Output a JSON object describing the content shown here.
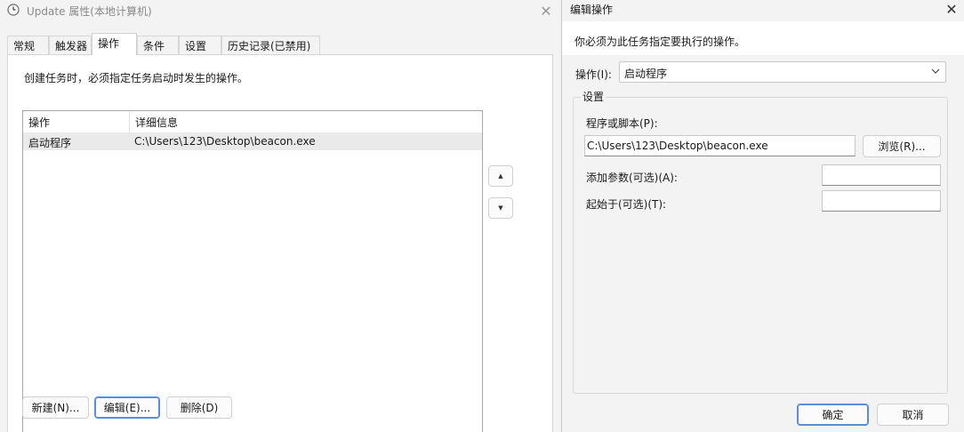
{
  "left_window": {
    "title": "Update 属性(本地计算机)",
    "tabs": [
      "常规",
      "触发器",
      "操作",
      "条件",
      "设置",
      "历史记录(已禁用)"
    ],
    "active_tab_index": 2,
    "description": "创建任务时，必须指定任务启动时发生的操作。",
    "table": {
      "headers": [
        "操作",
        "详细信息"
      ],
      "rows": [
        {
          "action": "启动程序",
          "details": "C:\\Users\\123\\Desktop\\beacon.exe"
        }
      ]
    },
    "buttons": {
      "new": "新建(N)...",
      "edit": "编辑(E)...",
      "delete": "删除(D)"
    },
    "icons": {
      "app": "clock-icon",
      "close": "close-icon",
      "move_up": "triangle-up-icon",
      "move_down": "triangle-down-icon"
    }
  },
  "right_window": {
    "title": "编辑操作",
    "instruction": "你必须为此任务指定要执行的操作。",
    "action_label": "操作(I):",
    "action_value": "启动程序",
    "settings_legend": "设置",
    "program_label": "程序或脚本(P):",
    "program_value": "C:\\Users\\123\\Desktop\\beacon.exe",
    "browse": "浏览(R)...",
    "args_label": "添加参数(可选)(A):",
    "args_value": "",
    "start_in_label": "起始于(可选)(T):",
    "start_in_value": "",
    "ok": "确定",
    "cancel": "取消",
    "icons": {
      "close": "close-icon",
      "dropdown": "chevron-down-icon"
    }
  },
  "colors": {
    "focus_border": "#5a8fd8",
    "selected_row": "#eaeaea",
    "window_bg": "#f3f3f3"
  }
}
